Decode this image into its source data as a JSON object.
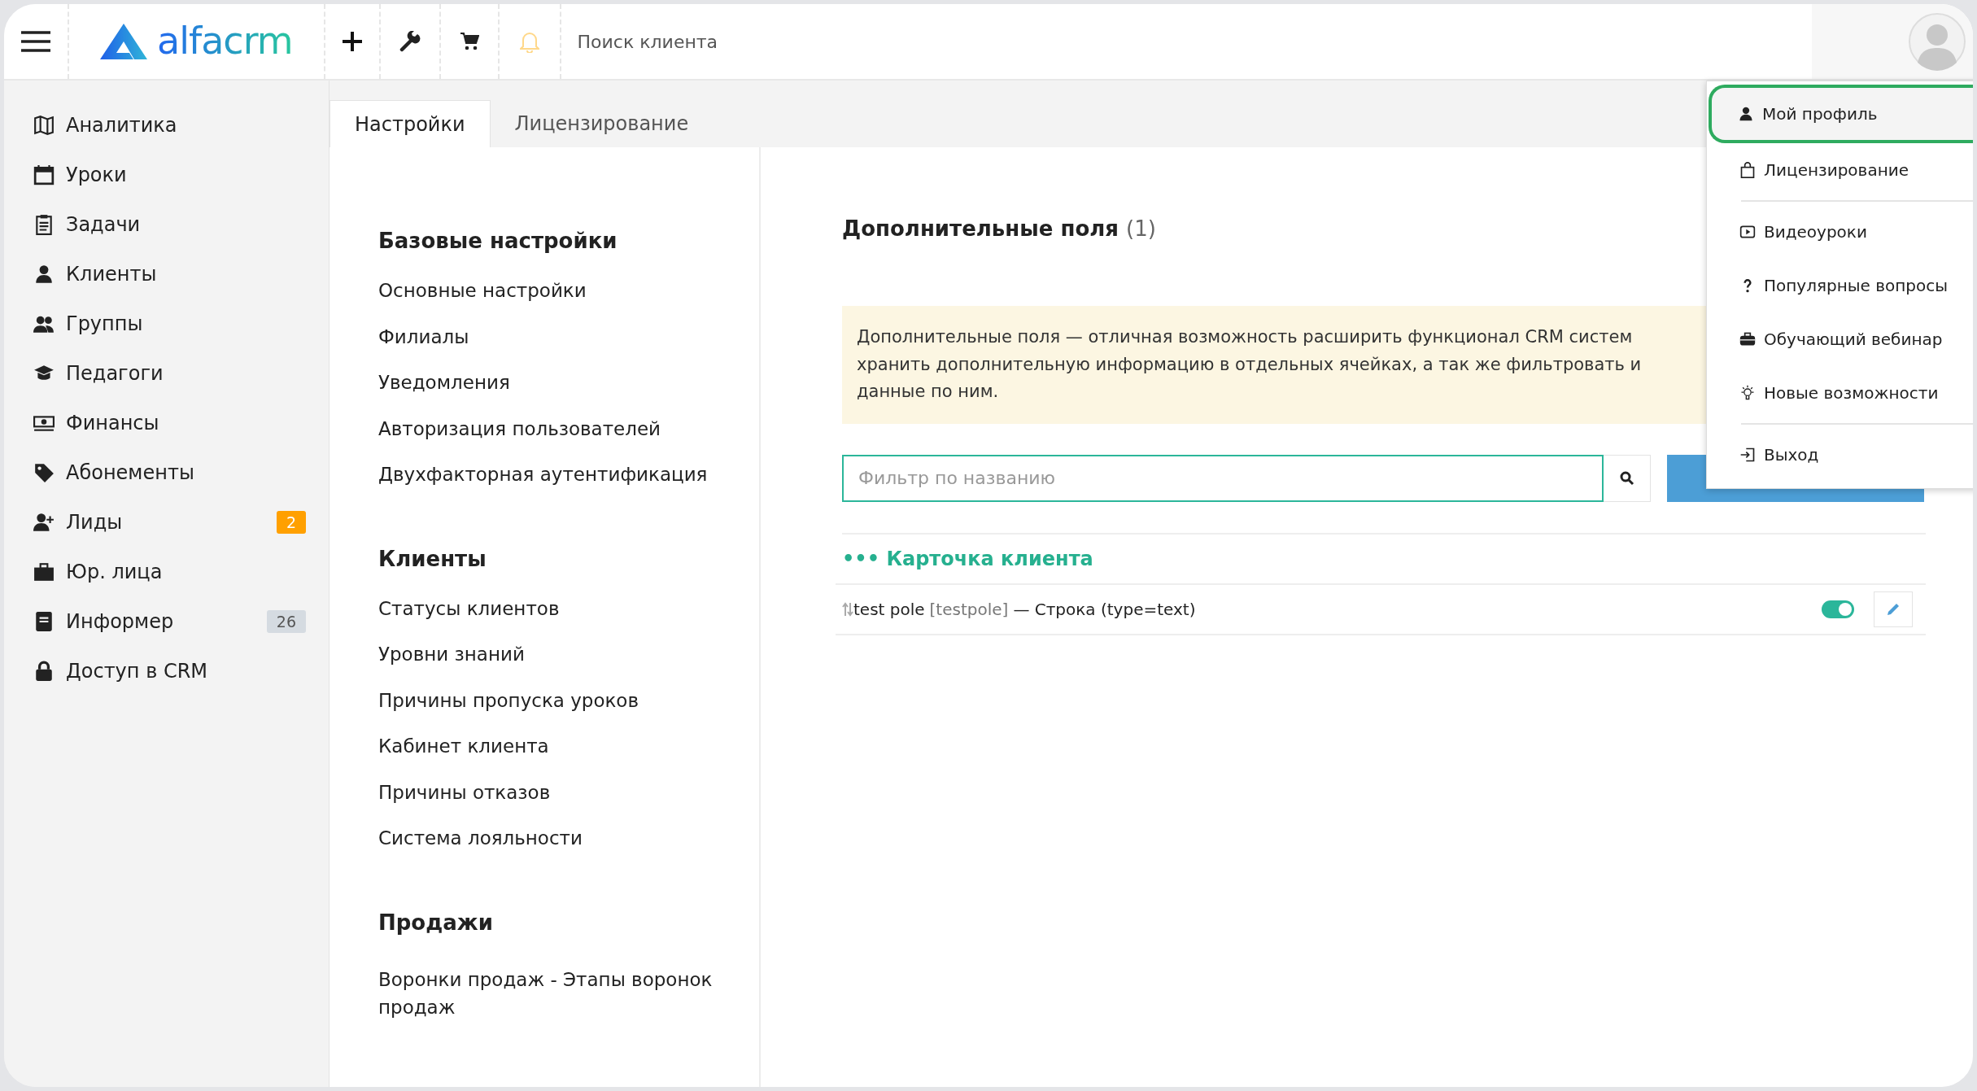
{
  "topbar": {
    "logo": "alfacrm",
    "search": {
      "placeholder": "Поиск клиента"
    }
  },
  "sidebar": {
    "items": [
      {
        "label": "Аналитика"
      },
      {
        "label": "Уроки"
      },
      {
        "label": "Задачи"
      },
      {
        "label": "Клиенты"
      },
      {
        "label": "Группы"
      },
      {
        "label": "Педагоги"
      },
      {
        "label": "Финансы"
      },
      {
        "label": "Абонементы"
      },
      {
        "label": "Лиды",
        "badge": {
          "text": "2",
          "color": "#ffa000"
        }
      },
      {
        "label": "Юр. лица"
      },
      {
        "label": "Информер",
        "badge": {
          "text": "26",
          "color": "#d5dbe1"
        }
      },
      {
        "label": "Доступ в CRM"
      }
    ]
  },
  "tabs": [
    {
      "label": "Настройки",
      "selected": true
    },
    {
      "label": "Лицензирование",
      "selected": false
    }
  ],
  "settings_nav": [
    {
      "heading": "Базовые настройки",
      "items": [
        "Основные настройки",
        "Филиалы",
        "Уведомления",
        "Авторизация пользователей",
        "Двухфакторная аутентификация"
      ]
    },
    {
      "heading": "Клиенты",
      "items": [
        "Статусы клиентов",
        "Уровни знаний",
        "Причины пропуска уроков",
        "Кабинет клиента",
        "Причины отказов",
        "Система лояльности"
      ]
    },
    {
      "heading": "Продажи",
      "items": [
        "Воронки продаж - Этапы воронок продаж"
      ]
    }
  ],
  "content": {
    "title": "Дополнительные поля",
    "count": "(1)",
    "notice": [
      "Дополнительные поля — отличная возможность расширить функционал CRM систем",
      "хранить дополнительную информацию в отдельных ячейках, а так же фильтровать и",
      "данные по ним."
    ],
    "filter": {
      "placeholder": "Фильтр по названию"
    },
    "group": {
      "label": "••• Карточка клиента",
      "fields": [
        {
          "name": "test pole",
          "key": "[testpole]",
          "type": "— Строка (type=text)",
          "on": true
        }
      ]
    }
  },
  "profile_menu": {
    "items": [
      {
        "label": "Мой профиль",
        "selected": true
      },
      {
        "label": "Лицензирование",
        "selected": false
      },
      {
        "label": "Видеоуроки",
        "selected": false,
        "divider_before": true
      },
      {
        "label": "Популярные вопросы",
        "selected": false
      },
      {
        "label": "Обучающий вебинар",
        "selected": false
      },
      {
        "label": "Новые возможности",
        "selected": false
      },
      {
        "label": "Выход",
        "selected": false,
        "divider_before": true
      }
    ]
  }
}
